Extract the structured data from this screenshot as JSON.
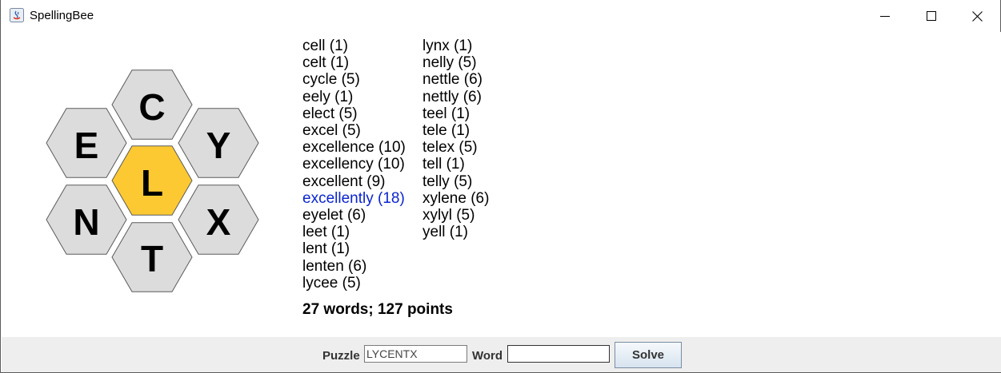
{
  "window": {
    "title": "SpellingBee"
  },
  "hive": {
    "center": "L",
    "top": "C",
    "upper_left": "E",
    "upper_right": "Y",
    "lower_left": "N",
    "lower_right": "X",
    "bottom": "T",
    "center_color": "#fcc933",
    "outer_color": "#dcdcdc"
  },
  "words": {
    "column1": [
      "cell (1)",
      "celt (1)",
      "cycle (5)",
      "eely (1)",
      "elect (5)",
      "excel (5)",
      "excellence (10)",
      "excellency (10)",
      "excellent (9)",
      "excellently (18)",
      "eyelet (6)",
      "leet (1)",
      "lent (1)",
      "lenten (6)",
      "lycee (5)"
    ],
    "column2": [
      "lynx (1)",
      "nelly (5)",
      "nettle (6)",
      "nettly (6)",
      "teel (1)",
      "tele (1)",
      "telex (5)",
      "tell (1)",
      "telly (5)",
      "xylene (6)",
      "xylyl (5)",
      "yell (1)"
    ],
    "highlighted": "excellently (18)",
    "highlight_color": "#0a24d1"
  },
  "summary": "27 words; 127 points",
  "controls": {
    "puzzle_label": "Puzzle",
    "puzzle_value": "LYCENTX",
    "word_label": "Word",
    "word_value": "",
    "solve_label": "Solve"
  }
}
